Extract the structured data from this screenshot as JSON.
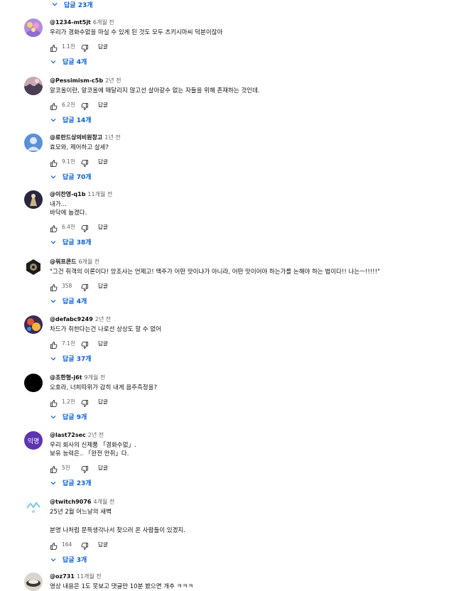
{
  "top_replies": "답글 23개",
  "comments": [
    {
      "author": "@1234-mt5jt",
      "time": "6개월 전",
      "lines": [
        "우리가 경화수없을 마실 수 있게 된 것도 모두 츠키시마씨 덕분이잖아"
      ],
      "likes": "1.1천",
      "reply_label": "답글",
      "replies": "답글 4개"
    },
    {
      "author": "@Pessimism-c5b",
      "time": "2년 전",
      "lines": [
        "알코올이란, 알코올에 매달리지 않고선 살아갈수 없는 자들을 위해 존재하는 것인데."
      ],
      "likes": "6.2천",
      "reply_label": "답글",
      "replies": "답글 14개"
    },
    {
      "author": "@로란드상의비원창고",
      "time": "1년 전",
      "lines": [
        "효모와, 제어하고 살세?"
      ],
      "likes": "9.1천",
      "reply_label": "답글",
      "replies": "답글 70개"
    },
    {
      "author": "@이찬영-q1b",
      "time": "11개월 전",
      "lines": [
        "내가...",
        "바닥에 눕겠다."
      ],
      "likes": "6.4천",
      "reply_label": "답글",
      "replies": "답글 38개"
    },
    {
      "author": "@워프콘드",
      "time": "6개월 전",
      "lines": [
        "\"그건 취객의 이론이다! 앙조사는 언제고! 맥주가 어떤 맛이냐가 아니라, 어떤 맛이어야 하는가를 논해야 하는 법이다!! 나는ㅡ!!!!!\""
      ],
      "likes": "358",
      "reply_label": "답글",
      "replies": "답글 4개"
    },
    {
      "author": "@defabc9249",
      "time": "2년 전",
      "lines": [
        "차드가 취한다는건 나로선 상상도 할 수 없어"
      ],
      "likes": "7.1천",
      "reply_label": "답글",
      "replies": "답글 37개"
    },
    {
      "author": "@조한형-j6t",
      "time": "9개월 전",
      "lines": [
        "오호라, 너희따위가 감히 내게 음주측정을?"
      ],
      "likes": "1.2천",
      "reply_label": "답글",
      "replies": "답글 9개"
    },
    {
      "author": "@last72sec",
      "time": "2년 전",
      "lines": [
        "우리 회사의 신제품 「경화수없」.",
        "보유 능력은.. 「완전 만취」다."
      ],
      "likes": "5천",
      "reply_label": "답글",
      "replies": "답글 23개",
      "avatar_text": "익명"
    },
    {
      "author": "@twitch9076",
      "time": "4개월 전",
      "lines": [
        "25년 2월 어느날의 새벽",
        "",
        "분명 나처럼 문득생각나서 찾으러 온 사람들이 있겠지."
      ],
      "likes": "164",
      "reply_label": "답글",
      "replies": "답글 3개"
    },
    {
      "author": "@oz731",
      "time": "11개월 전",
      "lines": [
        "영상 내용은 1도 못보고 댓글만 10분 봤으면 개추 ㅋㅋㅋ"
      ],
      "likes": "",
      "reply_label": "답글",
      "replies": ""
    }
  ],
  "colors": {
    "link_blue": "#065fd4",
    "meta_gray": "#606060",
    "text": "#0f0f0f",
    "avatar_purple": "#5e35b1",
    "avatar_default": "#5b8fd8"
  }
}
